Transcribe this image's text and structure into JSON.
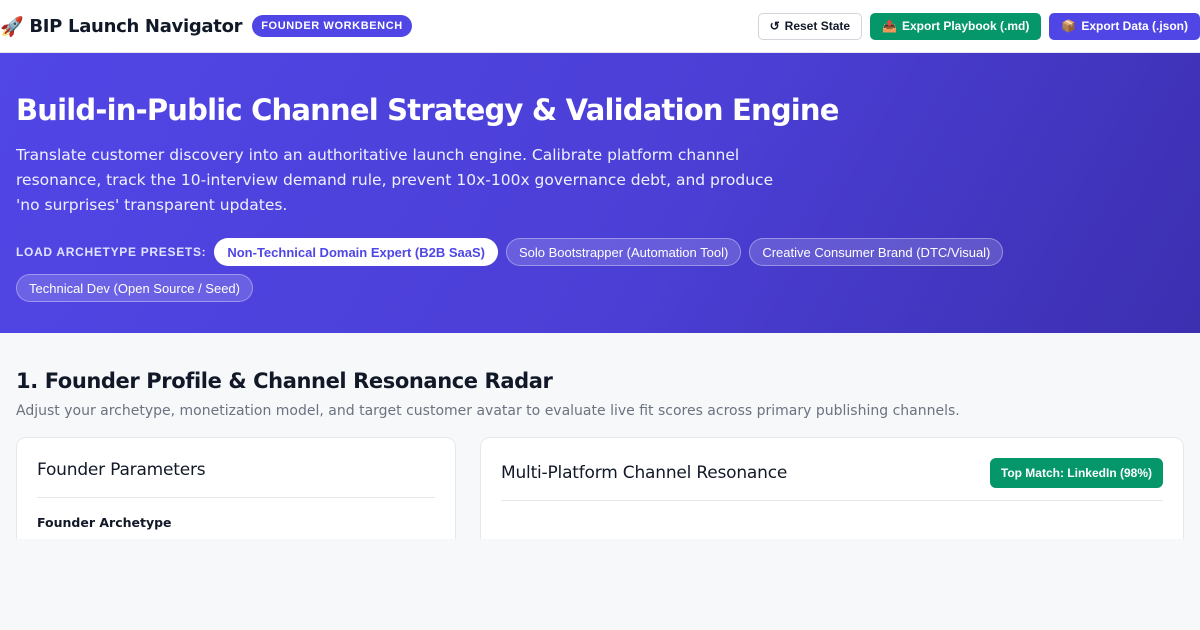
{
  "topbar": {
    "title": "BIP Launch Navigator",
    "title_icon": "rocket-icon",
    "badge": "FOUNDER WORKBENCH",
    "actions": {
      "reset": {
        "label": "Reset State",
        "icon": "↺"
      },
      "export_playbook": {
        "label": "Export Playbook (.md)",
        "icon": "📤"
      },
      "export_data": {
        "label": "Export Data (.json)",
        "icon": "📦"
      }
    }
  },
  "hero": {
    "title": "Build-in-Public Channel Strategy & Validation Engine",
    "description": "Translate customer discovery into an authoritative launch engine. Calibrate platform channel resonance, track the 10-interview demand rule, prevent 10x-100x governance debt, and produce 'no surprises' transparent updates.",
    "presets_label": "LOAD ARCHETYPE PRESETS:",
    "presets": [
      {
        "label": "Non-Technical Domain Expert (B2B SaaS)",
        "active": true
      },
      {
        "label": "Solo Bootstrapper (Automation Tool)",
        "active": false
      },
      {
        "label": "Creative Consumer Brand (DTC/Visual)",
        "active": false
      },
      {
        "label": "Technical Dev (Open Source / Seed)",
        "active": false
      }
    ]
  },
  "section1": {
    "title": "1. Founder Profile & Channel Resonance Radar",
    "subtitle": "Adjust your archetype, monetization model, and target customer avatar to evaluate live fit scores across primary publishing channels.",
    "params_card": {
      "title": "Founder Parameters",
      "field_label": "Founder Archetype"
    },
    "resonance_card": {
      "title": "Multi-Platform Channel Resonance",
      "top_match": "Top Match: LinkedIn (98%)"
    }
  },
  "colors": {
    "accent": "#4f46e5",
    "success": "#059669",
    "hero_gradient_start": "#5146e6",
    "hero_gradient_end": "#3c2fb0"
  }
}
